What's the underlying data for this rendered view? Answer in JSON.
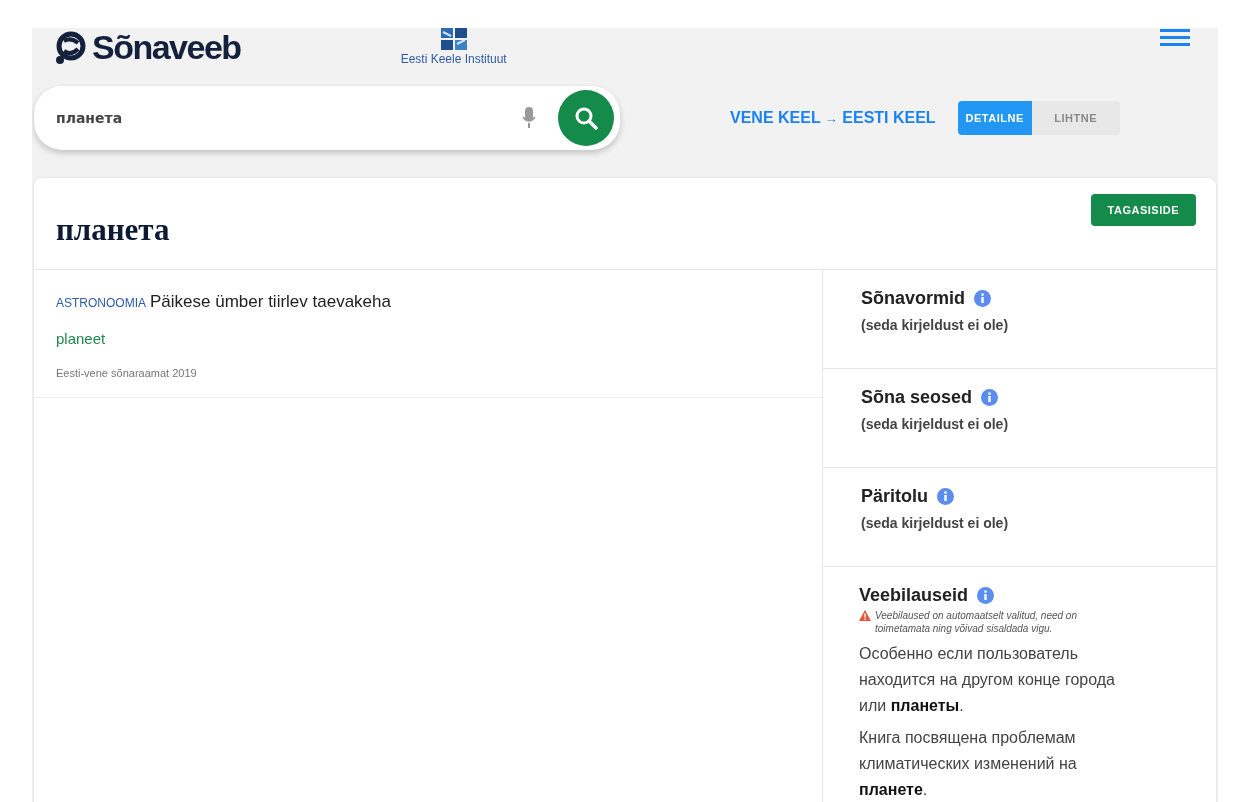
{
  "header": {
    "logo": "Sõnaveeb",
    "institute": "Eesti Keele Instituut"
  },
  "search": {
    "value": "планета"
  },
  "language": {
    "source": "VENE KEEL",
    "arrow": "→",
    "target": "EESTI KEEL"
  },
  "modes": [
    {
      "label": "DETAILNE",
      "selected": true
    },
    {
      "label": "LIHTNE",
      "selected": false
    }
  ],
  "entry": {
    "headword": "планета",
    "feedback_button": "TAGASISIDE",
    "meanings": [
      {
        "domain": "ASTRONOOMIA",
        "definition": "Päikese ümber tiirlev taevakeha",
        "translation": "planeet",
        "source": "Eesti-vene sõnaraamat 2019"
      }
    ]
  },
  "sections": [
    {
      "kind": "empty",
      "title": "Sõnavormid",
      "note": "(seda kirjeldust ei ole)"
    },
    {
      "kind": "empty",
      "title": "Sõna seosed",
      "note": "(seda kirjeldust ei ole)"
    },
    {
      "kind": "empty",
      "title": "Päritolu",
      "note": "(seda kirjeldust ei ole)"
    },
    {
      "kind": "examples",
      "title": "Veebilauseid",
      "warning": "Veebilaused on automaatselt valitud, need on toimetamata ning võivad sisaldada vigu.",
      "sentences": [
        "Особенно если пользователь находится на другом конце города или **планеты**.",
        "Книга посвящена проблемам климатических изменений на **планете**."
      ]
    }
  ]
}
